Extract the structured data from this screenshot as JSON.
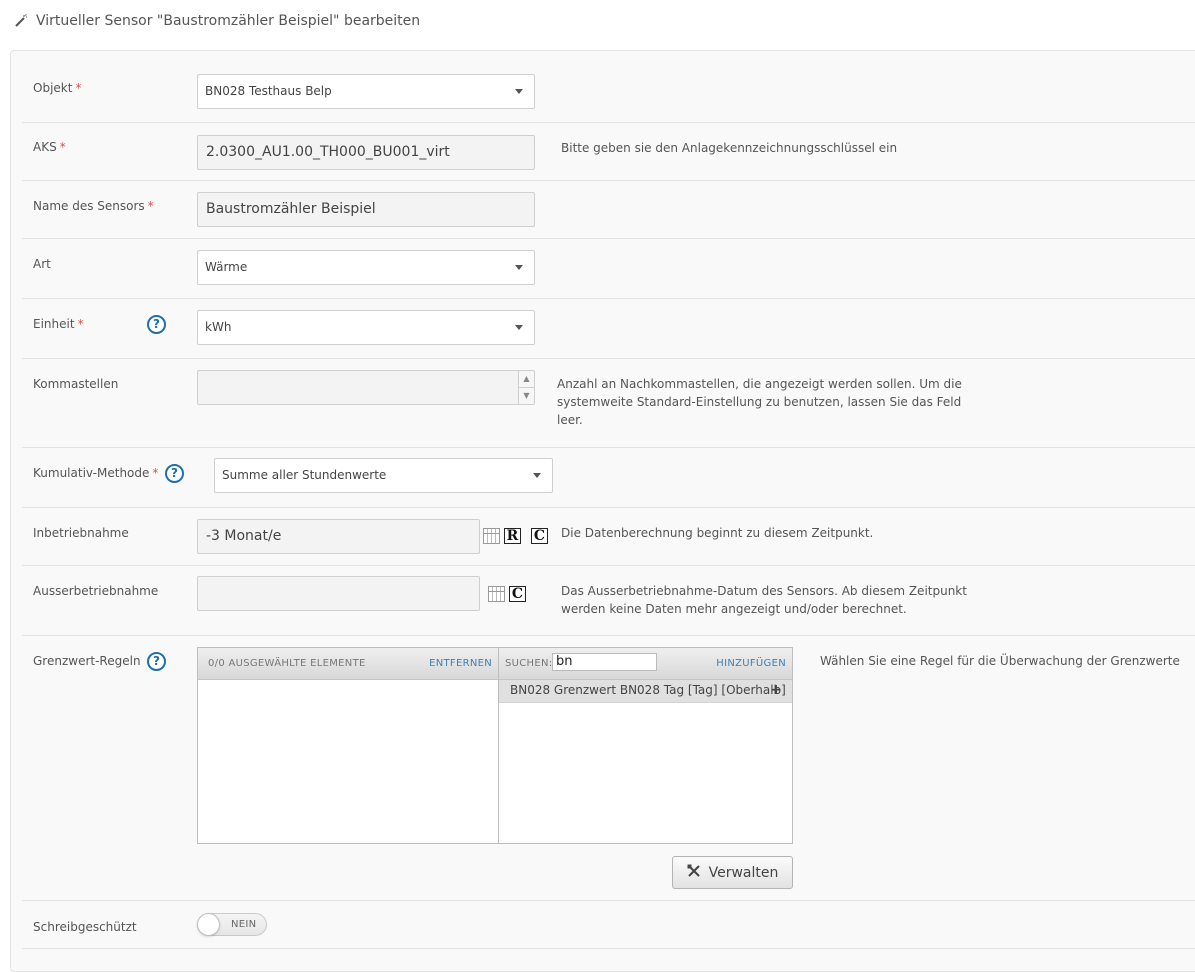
{
  "page": {
    "title": "Virtueller Sensor \"Baustromzähler Beispiel\" bearbeiten",
    "title_icon": "magic-wand-icon"
  },
  "form": {
    "required_marker": "*",
    "objekt": {
      "label": "Objekt",
      "value": "BN028 Testhaus Belp"
    },
    "aks": {
      "label": "AKS",
      "value": "2.0300_AU1.00_TH000_BU001_virt",
      "hint": "Bitte geben sie den Anlagekennzeichnungsschlüssel ein"
    },
    "name": {
      "label": "Name des Sensors",
      "value": "Baustromzähler Beispiel"
    },
    "art": {
      "label": "Art",
      "value": "Wärme"
    },
    "einheit": {
      "label": "Einheit",
      "value": "kWh",
      "help_icon": "question-circle-icon"
    },
    "kommastellen": {
      "label": "Kommastellen",
      "value": "",
      "hint_lines": [
        "Anzahl an Nachkommastellen, die angezeigt werden sollen. Um die",
        "systemweite Standard-Einstellung zu benutzen, lassen Sie das Feld",
        "leer."
      ]
    },
    "kumulativ": {
      "label": "Kumulativ-Methode",
      "value": "Summe aller Stundenwerte",
      "help_icon": "question-circle-icon"
    },
    "inbetriebnahme": {
      "label": "Inbetriebnahme",
      "value": "-3 Monat/e",
      "btn_r": "R",
      "btn_c": "C",
      "hint": "Die Datenberechnung beginnt zu diesem Zeitpunkt."
    },
    "ausserbetriebnahme": {
      "label": "Ausserbetriebnahme",
      "value": "",
      "btn_c": "C",
      "hint_lines": [
        "Das Ausserbetriebnahme-Datum des Sensors. Ab diesem Zeitpunkt",
        "werden keine Daten mehr angezeigt und/oder berechnet."
      ]
    },
    "grenzwert": {
      "label": "Grenzwert-Regeln",
      "help_icon": "question-circle-icon",
      "selected_header": "0/0 AUSGEWÄHLTE ELEMENTE",
      "remove_label": "ENTFERNEN",
      "search_label": "SUCHEN:",
      "search_value": "bn",
      "add_label": "HINZUFÜGEN",
      "available_items": [
        "BN028 Grenzwert BN028 Tag [Tag] [Oberhalb]"
      ],
      "hint": "Wählen Sie eine Regel für die Überwachung der Grenzwerte",
      "manage_label": "Verwalten"
    },
    "schreibgeschuetzt": {
      "label": "Schreibgeschützt",
      "toggle_value": "NEIN"
    }
  },
  "colors": {
    "required": "#d9534f",
    "help": "#1f6fa8",
    "link": "#3e7fb3"
  }
}
